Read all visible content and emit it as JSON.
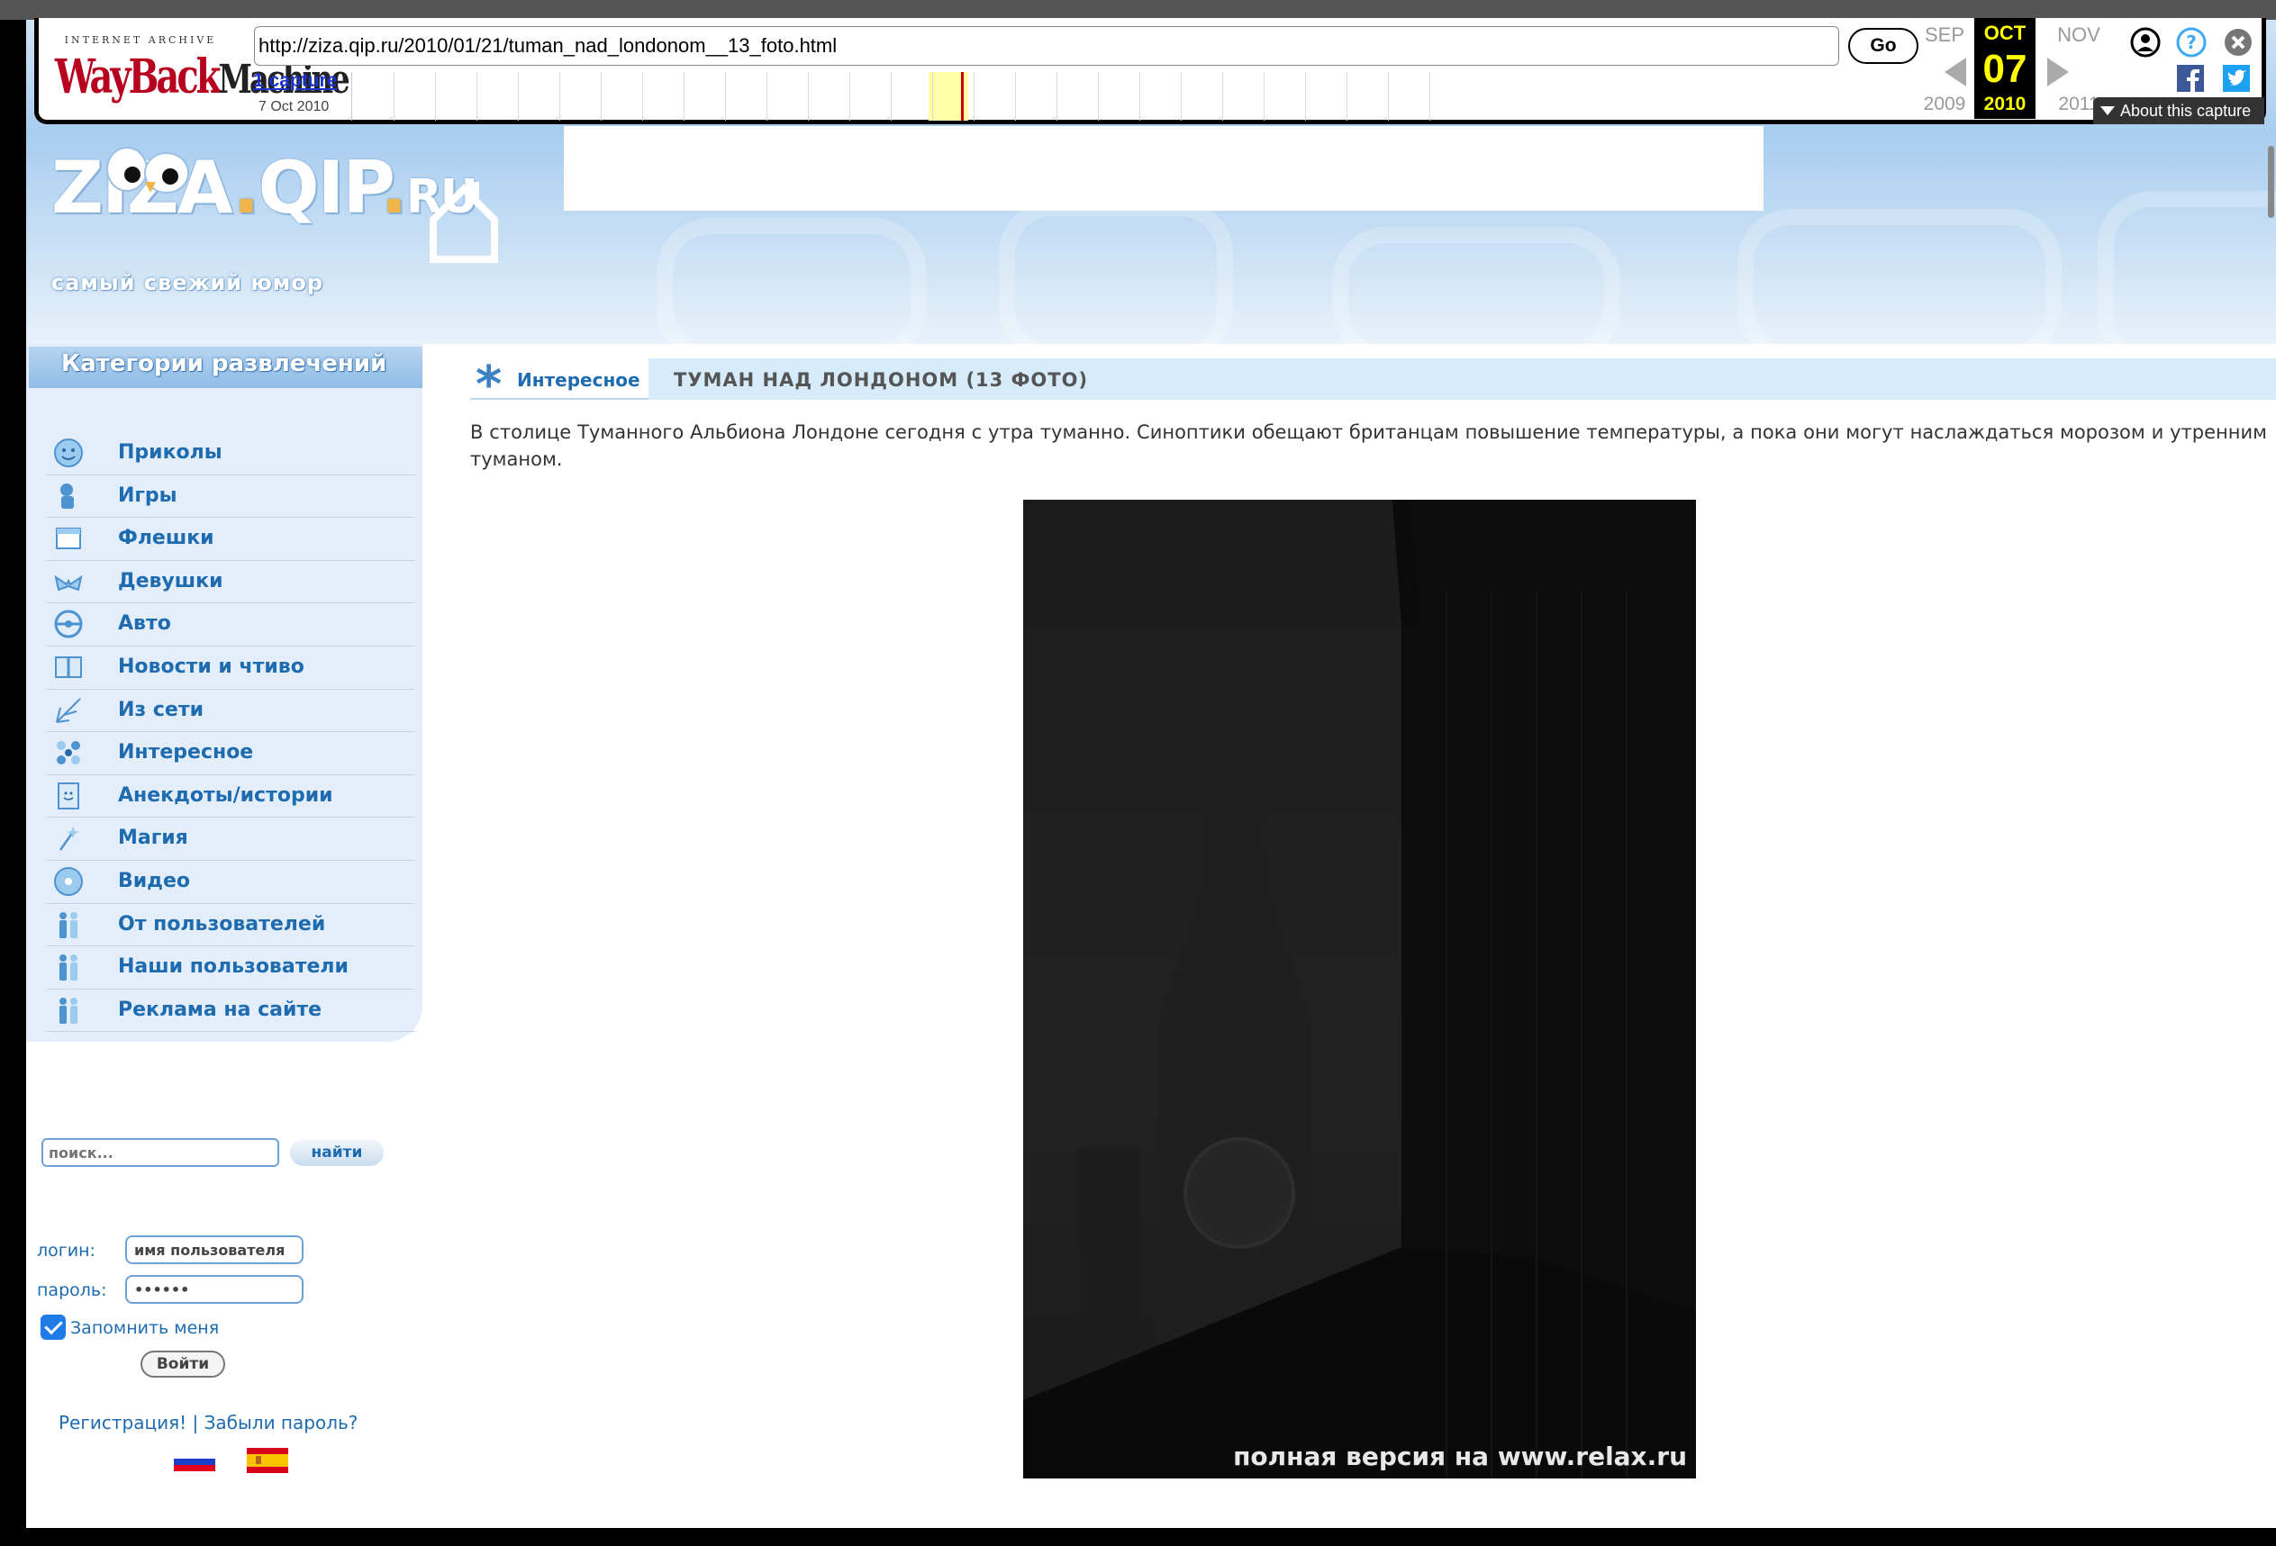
{
  "wayback": {
    "logo_top": "INTERNET ARCHIVE",
    "logo_main": "WayBack",
    "logo_machine": "Machine",
    "url": "http://ziza.qip.ru/2010/01/21/tuman_nad_londonom__13_foto.html",
    "go_label": "Go",
    "captures_link": "1 capture",
    "captures_date": "7 Oct 2010",
    "cal_prev_month": "SEP",
    "cal_month": "OCT",
    "cal_next_month": "NOV",
    "cal_prev_year": "2009",
    "cal_day": "07",
    "cal_year": "2010",
    "cal_next_year": "2011",
    "about_label": "About this capture",
    "sparkline_bar_count": 26
  },
  "site": {
    "logo_main": "ZIZA",
    "logo_dot1": ".",
    "logo_qip": "QIP",
    "logo_dot2": ".",
    "logo_ru": "RU",
    "tagline": "самый свежий юмор"
  },
  "sidebar": {
    "header": "Категории развлечений",
    "items": [
      {
        "label": "Приколы",
        "icon": "smiley-icon"
      },
      {
        "label": "Игры",
        "icon": "games-icon"
      },
      {
        "label": "Флешки",
        "icon": "flash-icon"
      },
      {
        "label": "Девушки",
        "icon": "bikini-icon"
      },
      {
        "label": "Авто",
        "icon": "steering-wheel-icon"
      },
      {
        "label": "Новости и чтиво",
        "icon": "book-icon"
      },
      {
        "label": "Из сети",
        "icon": "network-icon"
      },
      {
        "label": "Интересное",
        "icon": "sparkle-icon"
      },
      {
        "label": "Анекдоты/истории",
        "icon": "document-icon"
      },
      {
        "label": "Магия",
        "icon": "magic-wand-icon"
      },
      {
        "label": "Видео",
        "icon": "disc-icon"
      },
      {
        "label": "От пользователей",
        "icon": "users-icon"
      },
      {
        "label": "Наши пользователи",
        "icon": "users-icon"
      },
      {
        "label": "Реклама на сайте",
        "icon": "users-icon"
      }
    ]
  },
  "search": {
    "placeholder": "поиск...",
    "button": "найти"
  },
  "login": {
    "login_label": "логин:",
    "login_value": "имя пользователя",
    "password_label": "пароль:",
    "password_value": "••••••",
    "remember_label": "Запомнить меня",
    "submit": "Войти",
    "register": "Регистрация!",
    "separator": " | ",
    "forgot": "Забыли пароль?"
  },
  "article": {
    "category": "Интересное",
    "title": "ТУМАН НАД ЛОНДОНОМ (13 ФОТО)",
    "text": "В столице Туманного Альбиона Лондоне сегодня с утра туманно. Синоптики обещают британцам повышение температуры, а пока они могут наслаждаться морозом и утренним туманом.",
    "photo_caption": "полная версия на www.relax.ru"
  },
  "colors": {
    "link_blue": "#1e6bb0",
    "wayback_red": "#b8001f",
    "calendar_yellow": "#ffff00"
  }
}
